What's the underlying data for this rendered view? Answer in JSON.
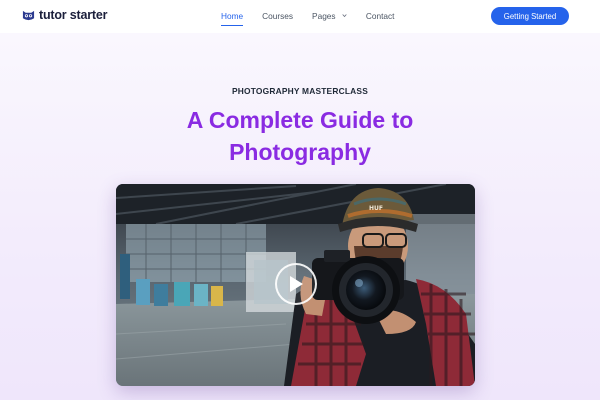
{
  "brand": {
    "name": "tutor starter",
    "logo_icon": "owl-logo-icon",
    "accent": "#2563eb"
  },
  "nav": {
    "items": [
      {
        "label": "Home",
        "active": true
      },
      {
        "label": "Courses",
        "active": false
      },
      {
        "label": "Pages",
        "active": false,
        "has_dropdown": true
      },
      {
        "label": "Contact",
        "active": false
      }
    ],
    "cta_label": "Getting Started"
  },
  "hero": {
    "eyebrow": "PHOTOGRAPHY MASTERCLASS",
    "title_line1": "A Complete Guide to",
    "title_line2": "Photography",
    "title_color": "#8a2be2",
    "media": {
      "play_icon": "play-icon"
    }
  }
}
